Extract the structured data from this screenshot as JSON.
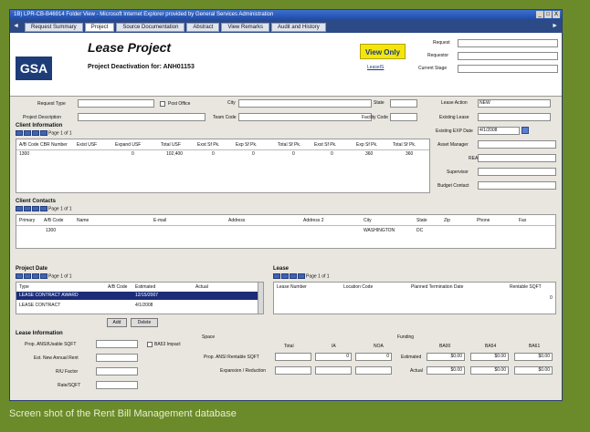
{
  "window": {
    "title": "1B) LPR-CB-B46914 Folder View - Microsoft Internet Explorer provided by General Services Administration",
    "controls": [
      "_",
      "□",
      "X"
    ]
  },
  "tabs": [
    "Request Summary",
    "Project",
    "Source Documentation",
    "Abstract",
    "View Remarks",
    "Audit and History"
  ],
  "header": {
    "logo": "GSA",
    "title": "Lease Project",
    "subtitle": "Project Deactivation for: ANH01153",
    "view_only": "View Only",
    "lease_link": "LeaseIS",
    "request_label": "Request",
    "requestor_label": "Requestor",
    "current_stage_label": "Current Stage"
  },
  "form": {
    "request_type": "Request Type",
    "post_office": "Post Office",
    "city": "City",
    "state": "State",
    "lease_action": "Lease Action",
    "lease_action_value": "NEW",
    "project_description": "Project Description",
    "team_code": "Team Code",
    "facility_code": "Facility Code",
    "existing_lease": "Existing Lease",
    "existing_exp_date": "Existing EXP Date",
    "existing_exp_date_value": "4/1/2008",
    "asset_manager": "Asset Manager",
    "rea": "REA",
    "supervisor": "Supervisor",
    "budget_contact": "Budget Contact"
  },
  "client_info": {
    "title": "Client Information",
    "page": "Page 1 of 1",
    "columns": [
      "A/B Code",
      "CBR Number",
      "Exist USF",
      "Expand USF",
      "Total USF",
      "Exst Sf Pk.",
      "Exp Sf Pk.",
      "Total Sf Pk.",
      "Exst Sf Pk.",
      "Exp Sf Pk.",
      "Total Sf Pk."
    ],
    "row": [
      "1300",
      "",
      "",
      "0",
      "102,400",
      "0",
      "0",
      "0",
      "0",
      "360",
      "360"
    ]
  },
  "client_contacts": {
    "title": "Client Contacts",
    "page": "Page 1 of 1",
    "columns": [
      "Primary",
      "A/B Code",
      "Name",
      "E-mail",
      "Address",
      "Address 2",
      "City",
      "State",
      "Zip",
      "Phone",
      "Fax"
    ],
    "row": [
      "",
      "1300",
      "",
      "",
      "",
      "",
      "WASHINGTON",
      "DC",
      "",
      "",
      ""
    ]
  },
  "project_date": {
    "title": "Project Date",
    "page": "Page 1 of 1",
    "columns": [
      "Type",
      "A/B Code",
      "Estimated",
      "Actual"
    ],
    "rows": [
      [
        "LEASE CONTRACT AWARD",
        "",
        "12/15/2007",
        ""
      ],
      [
        "LEASE CONTRACT",
        "",
        "4/1/2008",
        ""
      ]
    ],
    "add": "Add",
    "delete": "Delete"
  },
  "lease": {
    "title": "Lease",
    "page": "Page 1 of 1",
    "columns": [
      "Lease Number",
      "Location Code",
      "Planned Termination Date",
      "Rentable SQFT"
    ],
    "value": "0"
  },
  "lease_info": {
    "title": "Lease Information",
    "prop_ansi": "Prop. ANSI/Usable SQFT",
    "est_rent": "Est. New Annual Rent",
    "ru_factor": "R/U Factor",
    "rate_sqft": "Rate/SQFT",
    "bas_impact": "BA53 Impact"
  },
  "space": {
    "title": "Space",
    "columns": [
      "Total",
      "IA",
      "NOA"
    ],
    "prop_ansi_rent": "Prop. ANSI Rentable SQFT",
    "expansion": "Expansion / Reduction",
    "values": [
      "",
      "0",
      "0"
    ]
  },
  "funding": {
    "title": "Funding",
    "columns": [
      "BA00",
      "BA54",
      "BA61"
    ],
    "estimated": "Estimated",
    "actual": "Actual",
    "est_values": [
      "$0.00",
      "$0.00",
      "$0.00"
    ],
    "act_values": [
      "$0.00",
      "$0.00",
      "$0.00"
    ]
  },
  "caption": "Screen shot of the Rent Bill Management database"
}
